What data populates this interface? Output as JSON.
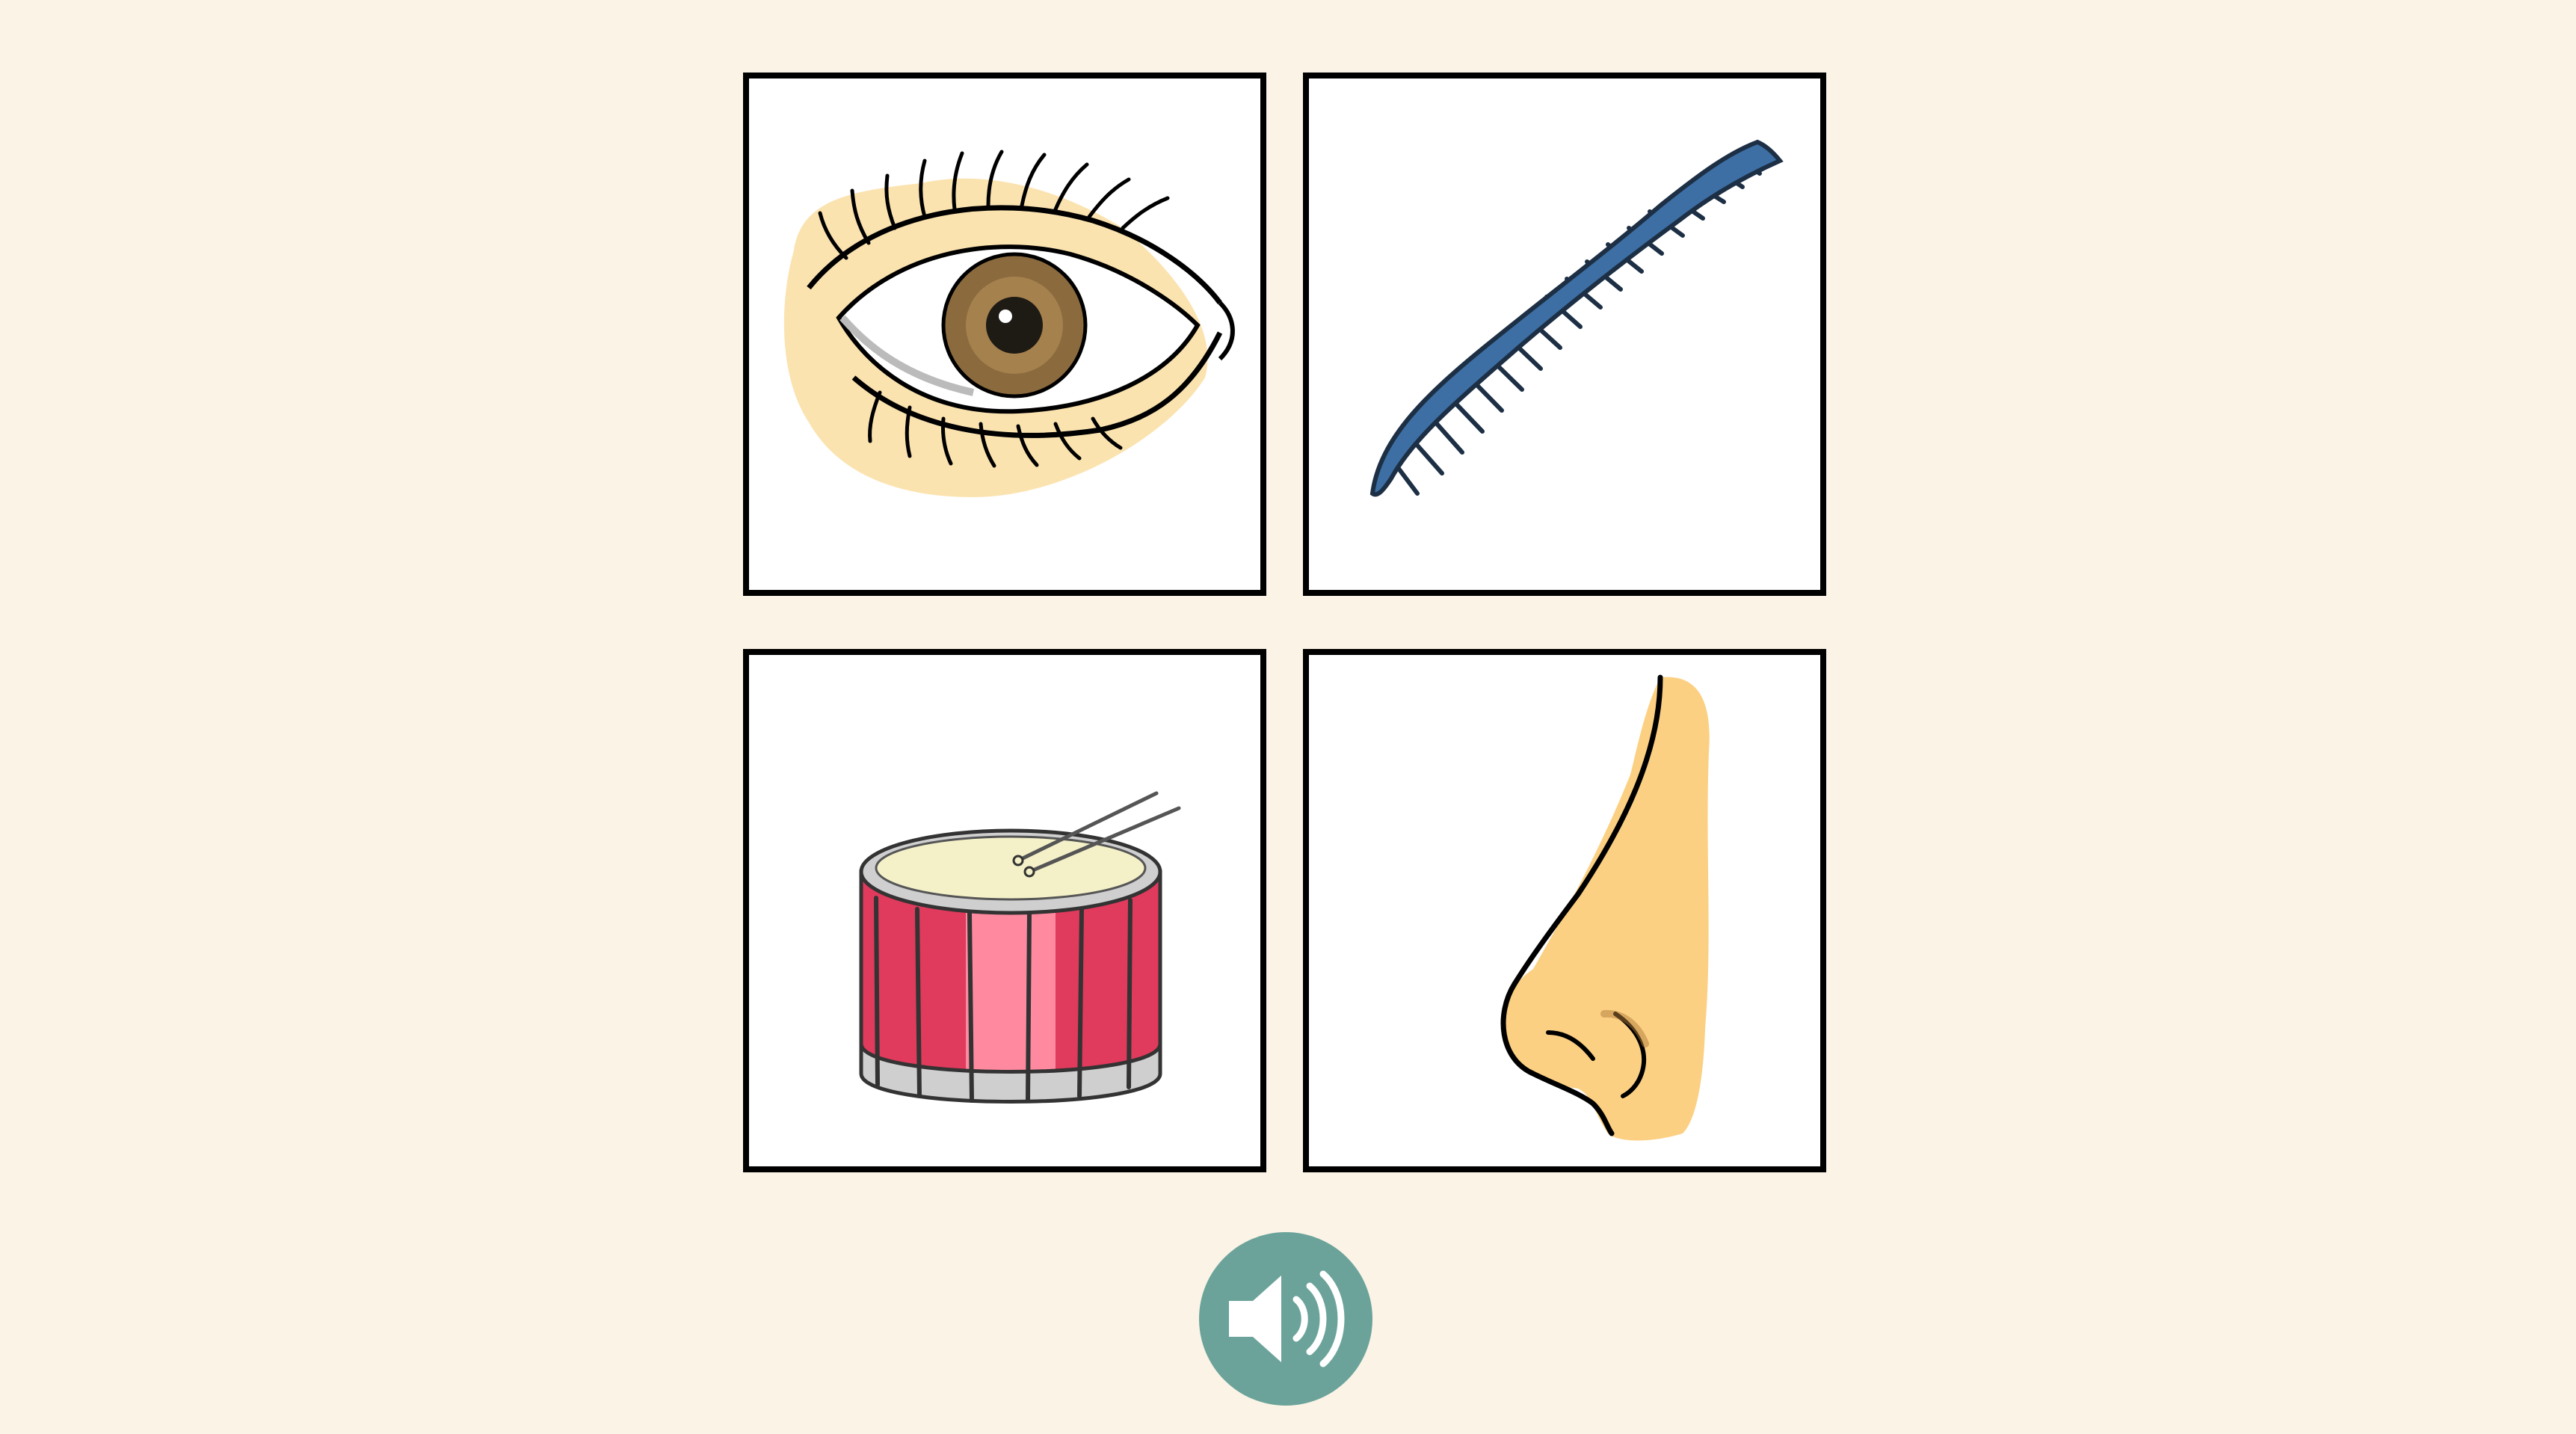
{
  "activity": {
    "cards": [
      {
        "id": "eye",
        "icon": "eye-icon"
      },
      {
        "id": "comb",
        "icon": "comb-icon"
      },
      {
        "id": "drum",
        "icon": "drum-icon"
      },
      {
        "id": "nose",
        "icon": "nose-icon"
      }
    ],
    "audio_button": {
      "icon": "speaker-icon"
    }
  },
  "colors": {
    "background": "#faf3e6",
    "card_fill": "#ffffff",
    "card_border": "#000000",
    "audio_button": "#6ba39a",
    "eye_skin": "#fbe3b0",
    "eye_iris": "#8b6a3e",
    "comb": "#3d6fa4",
    "drum_red": "#e03a5c",
    "drum_pink": "#ff8aa0",
    "drum_head": "#f4f1c8",
    "nose_skin": "#fcd083"
  }
}
